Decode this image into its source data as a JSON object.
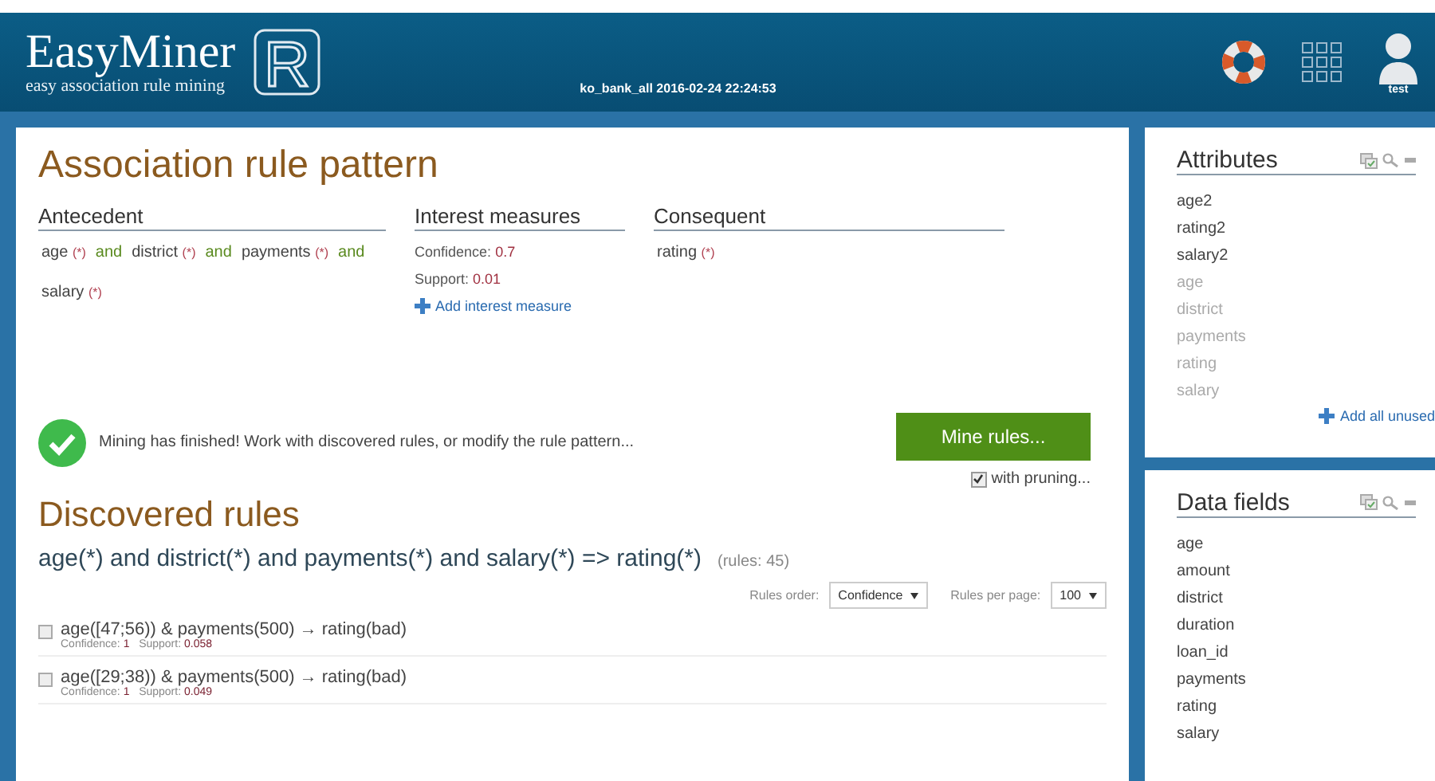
{
  "header": {
    "logo": "EasyMiner",
    "tagline": "easy association rule mining",
    "logo_mark": "R",
    "dataset": "ko_bank_all 2016-02-24 22:24:53",
    "user": "test"
  },
  "pattern": {
    "title": "Association rule pattern",
    "antecedent": {
      "heading": "Antecedent",
      "items": [
        {
          "kind": "attribute",
          "name": "age",
          "coef": "(*)"
        },
        {
          "kind": "connective",
          "text": "and"
        },
        {
          "kind": "attribute",
          "name": "district",
          "coef": "(*)"
        },
        {
          "kind": "connective",
          "text": "and"
        },
        {
          "kind": "attribute",
          "name": "payments",
          "coef": "(*)"
        },
        {
          "kind": "connective",
          "text": "and"
        },
        {
          "kind": "attribute",
          "name": "salary",
          "coef": "(*)"
        }
      ]
    },
    "measures": {
      "heading": "Interest measures",
      "items": [
        {
          "label": "Confidence:",
          "value": "0.7"
        },
        {
          "label": "Support:",
          "value": "0.01"
        }
      ],
      "add": "Add interest measure"
    },
    "consequent": {
      "heading": "Consequent",
      "items": [
        {
          "kind": "attribute",
          "name": "rating",
          "coef": "(*)"
        }
      ]
    },
    "status": "Mining has finished! Work with discovered rules, or modify the rule pattern...",
    "mine_button": "Mine rules...",
    "pruning": {
      "label": "with pruning...",
      "checked": true
    }
  },
  "rules": {
    "title": "Discovered rules",
    "query": "age(*) and district(*) and payments(*) and salary(*) => rating(*)",
    "count": "(rules: 45)",
    "order_label": "Rules order:",
    "order_value": "Confidence",
    "per_page_label": "Rules per page:",
    "per_page_value": "100",
    "items": [
      {
        "text": "age([47;56)) & payments(500) → rating(bad)",
        "checked": false,
        "confidence_label": "Confidence:",
        "confidence": "1",
        "support_label": "Support:",
        "support": "0.058"
      },
      {
        "text": "age([29;38)) & payments(500) → rating(bad)",
        "checked": false,
        "confidence_label": "Confidence:",
        "confidence": "1",
        "support_label": "Support:",
        "support": "0.049"
      }
    ]
  },
  "attributes": {
    "title": "Attributes",
    "items": [
      {
        "name": "age2",
        "used": false
      },
      {
        "name": "rating2",
        "used": false
      },
      {
        "name": "salary2",
        "used": false
      },
      {
        "name": "age",
        "used": true
      },
      {
        "name": "district",
        "used": true
      },
      {
        "name": "payments",
        "used": true
      },
      {
        "name": "rating",
        "used": true
      },
      {
        "name": "salary",
        "used": true
      }
    ],
    "add": "Add all unused"
  },
  "data_fields": {
    "title": "Data fields",
    "items": [
      "age",
      "amount",
      "district",
      "duration",
      "loan_id",
      "payments",
      "rating",
      "salary"
    ]
  }
}
